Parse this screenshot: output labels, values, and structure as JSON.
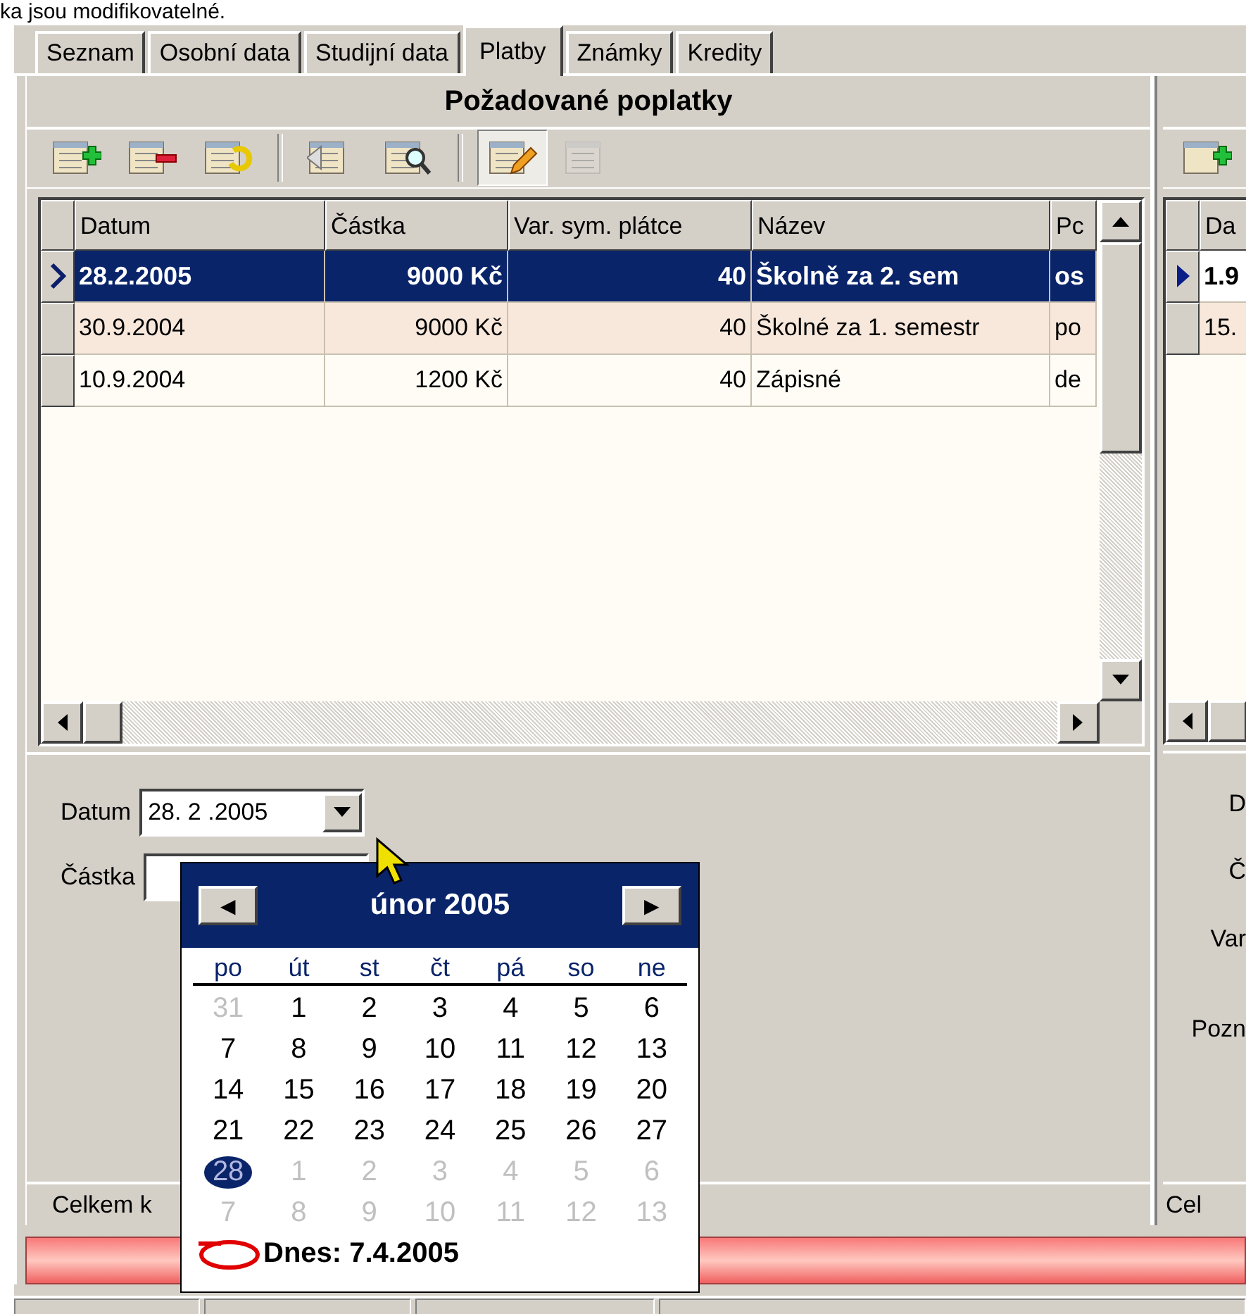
{
  "caption": "ka jsou modifikovatelné.",
  "tabs": [
    {
      "label": "Seznam",
      "selected": false
    },
    {
      "label": "Osobní data",
      "selected": false
    },
    {
      "label": "Studijní data",
      "selected": false
    },
    {
      "label": "Platby",
      "selected": true
    },
    {
      "label": "Známky",
      "selected": false
    },
    {
      "label": "Kredity",
      "selected": false
    }
  ],
  "left_panel": {
    "title": "Požadované poplatky",
    "toolbar": [
      [
        {
          "kind": "add",
          "pressed": false,
          "disabled": false
        },
        {
          "kind": "remove",
          "pressed": false,
          "disabled": false
        },
        {
          "kind": "undo",
          "pressed": false,
          "disabled": false
        }
      ],
      [
        {
          "kind": "view",
          "pressed": false,
          "disabled": false
        },
        {
          "kind": "search",
          "pressed": false,
          "disabled": false
        }
      ],
      [
        {
          "kind": "edit",
          "pressed": true,
          "disabled": false
        },
        {
          "kind": "form",
          "pressed": false,
          "disabled": true
        }
      ]
    ],
    "grid": {
      "focused": true,
      "columns": [
        "Datum",
        "Částka",
        "Var. sym. plátce",
        "Název",
        "Pc"
      ],
      "rows": [
        {
          "selected": true,
          "cells": [
            "28.2.2005",
            "9000 Kč",
            "40",
            "Školně za 2. sem",
            "os"
          ]
        },
        {
          "selected": false,
          "cells": [
            "30.9.2004",
            "9000 Kč",
            "40",
            "Školné za 1. semestr",
            "po"
          ]
        },
        {
          "selected": false,
          "cells": [
            "10.9.2004",
            "1200 Kč",
            "40",
            "Zápisné",
            "de"
          ]
        }
      ]
    },
    "form": [
      {
        "label": "Datum",
        "value": "28. 2 .2005"
      },
      {
        "label": "Částka"
      }
    ],
    "total_label": "Celkem k"
  },
  "right_panel": {
    "toolbar": [
      [
        {
          "kind": "add",
          "pressed": false,
          "disabled": false
        }
      ]
    ],
    "grid": {
      "focused": false,
      "columns": [
        "Da"
      ],
      "rows": [
        {
          "selected": true,
          "cells": [
            "1.9"
          ]
        },
        {
          "selected": false,
          "cells": [
            "15."
          ]
        }
      ]
    },
    "labels": [
      "D",
      "Č",
      "Var",
      "Pozn"
    ],
    "total_label": "Cel"
  },
  "calendar": {
    "month": "únor 2005",
    "prev": "◀",
    "next": "▶",
    "weekdays": [
      "po",
      "út",
      "st",
      "čt",
      "pá",
      "so",
      "ne"
    ],
    "weeks": [
      [
        {
          "day": "31",
          "other": true,
          "selected": false
        },
        {
          "day": "1",
          "other": false,
          "selected": false
        },
        {
          "day": "2",
          "other": false,
          "selected": false
        },
        {
          "day": "3",
          "other": false,
          "selected": false
        },
        {
          "day": "4",
          "other": false,
          "selected": false
        },
        {
          "day": "5",
          "other": false,
          "selected": false
        },
        {
          "day": "6",
          "other": false,
          "selected": false
        }
      ],
      [
        {
          "day": "7",
          "other": false,
          "selected": false
        },
        {
          "day": "8",
          "other": false,
          "selected": false
        },
        {
          "day": "9",
          "other": false,
          "selected": false
        },
        {
          "day": "10",
          "other": false,
          "selected": false
        },
        {
          "day": "11",
          "other": false,
          "selected": false
        },
        {
          "day": "12",
          "other": false,
          "selected": false
        },
        {
          "day": "13",
          "other": false,
          "selected": false
        }
      ],
      [
        {
          "day": "14",
          "other": false,
          "selected": false
        },
        {
          "day": "15",
          "other": false,
          "selected": false
        },
        {
          "day": "16",
          "other": false,
          "selected": false
        },
        {
          "day": "17",
          "other": false,
          "selected": false
        },
        {
          "day": "18",
          "other": false,
          "selected": false
        },
        {
          "day": "19",
          "other": false,
          "selected": false
        },
        {
          "day": "20",
          "other": false,
          "selected": false
        }
      ],
      [
        {
          "day": "21",
          "other": false,
          "selected": false
        },
        {
          "day": "22",
          "other": false,
          "selected": false
        },
        {
          "day": "23",
          "other": false,
          "selected": false
        },
        {
          "day": "24",
          "other": false,
          "selected": false
        },
        {
          "day": "25",
          "other": false,
          "selected": false
        },
        {
          "day": "26",
          "other": false,
          "selected": false
        },
        {
          "day": "27",
          "other": false,
          "selected": false
        }
      ],
      [
        {
          "day": "28",
          "other": false,
          "selected": true
        },
        {
          "day": "1",
          "other": true,
          "selected": false
        },
        {
          "day": "2",
          "other": true,
          "selected": false
        },
        {
          "day": "3",
          "other": true,
          "selected": false
        },
        {
          "day": "4",
          "other": true,
          "selected": false
        },
        {
          "day": "5",
          "other": true,
          "selected": false
        },
        {
          "day": "6",
          "other": true,
          "selected": false
        }
      ],
      [
        {
          "day": "7",
          "other": true,
          "selected": false
        },
        {
          "day": "8",
          "other": true,
          "selected": false
        },
        {
          "day": "9",
          "other": true,
          "selected": false
        },
        {
          "day": "10",
          "other": true,
          "selected": false
        },
        {
          "day": "11",
          "other": true,
          "selected": false
        },
        {
          "day": "12",
          "other": true,
          "selected": false
        },
        {
          "day": "13",
          "other": true,
          "selected": false
        }
      ]
    ],
    "today_label": "Dnes: 7.4.2005"
  }
}
